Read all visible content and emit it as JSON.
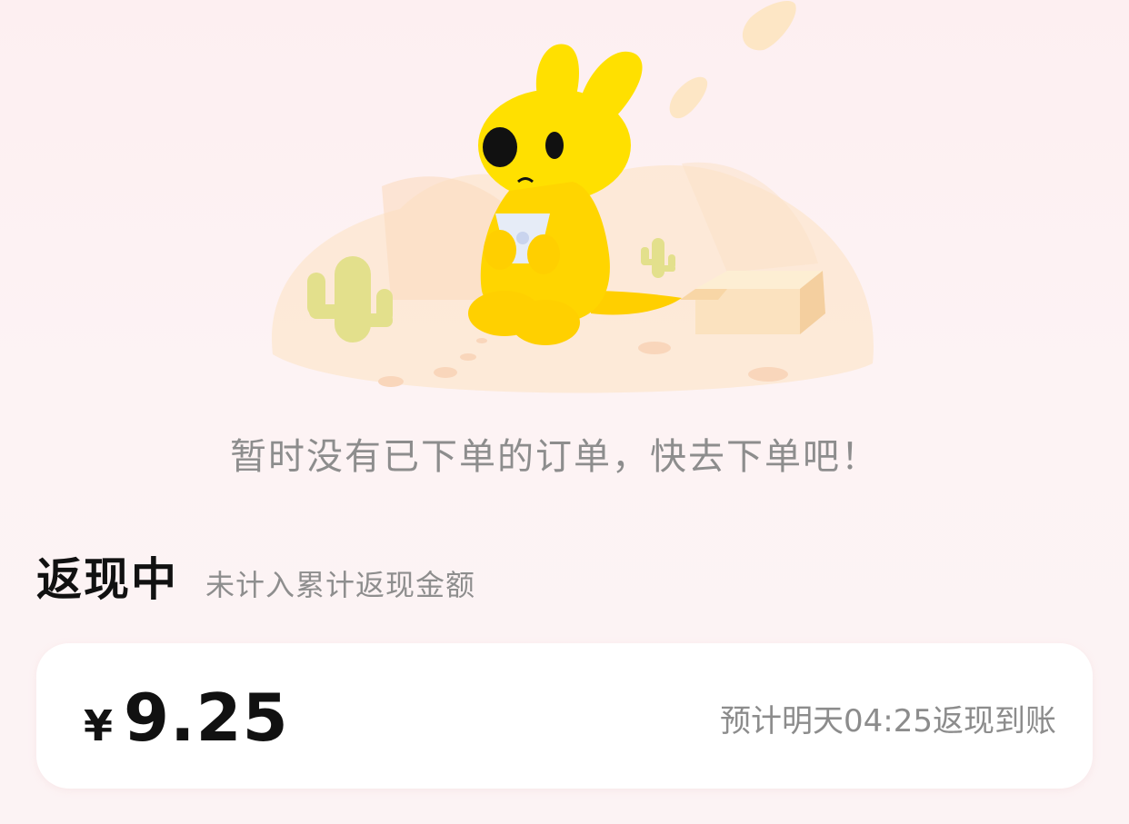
{
  "empty_state": {
    "message": "暂时没有已下单的订单，快去下单吧！"
  },
  "cashback_section": {
    "title": "返现中",
    "subtitle": "未计入累计返现金额"
  },
  "cashback_card": {
    "currency_symbol": "¥",
    "amount": "9.25",
    "eta_text": "预计明天04:25返现到账"
  },
  "colors": {
    "background": "#fdeff1",
    "mascot": "#ffd800",
    "text_primary": "#111111",
    "text_secondary": "#8d8d8d",
    "card": "#ffffff"
  },
  "icons": {
    "illustration": "kangaroo-empty-box-illustration"
  }
}
